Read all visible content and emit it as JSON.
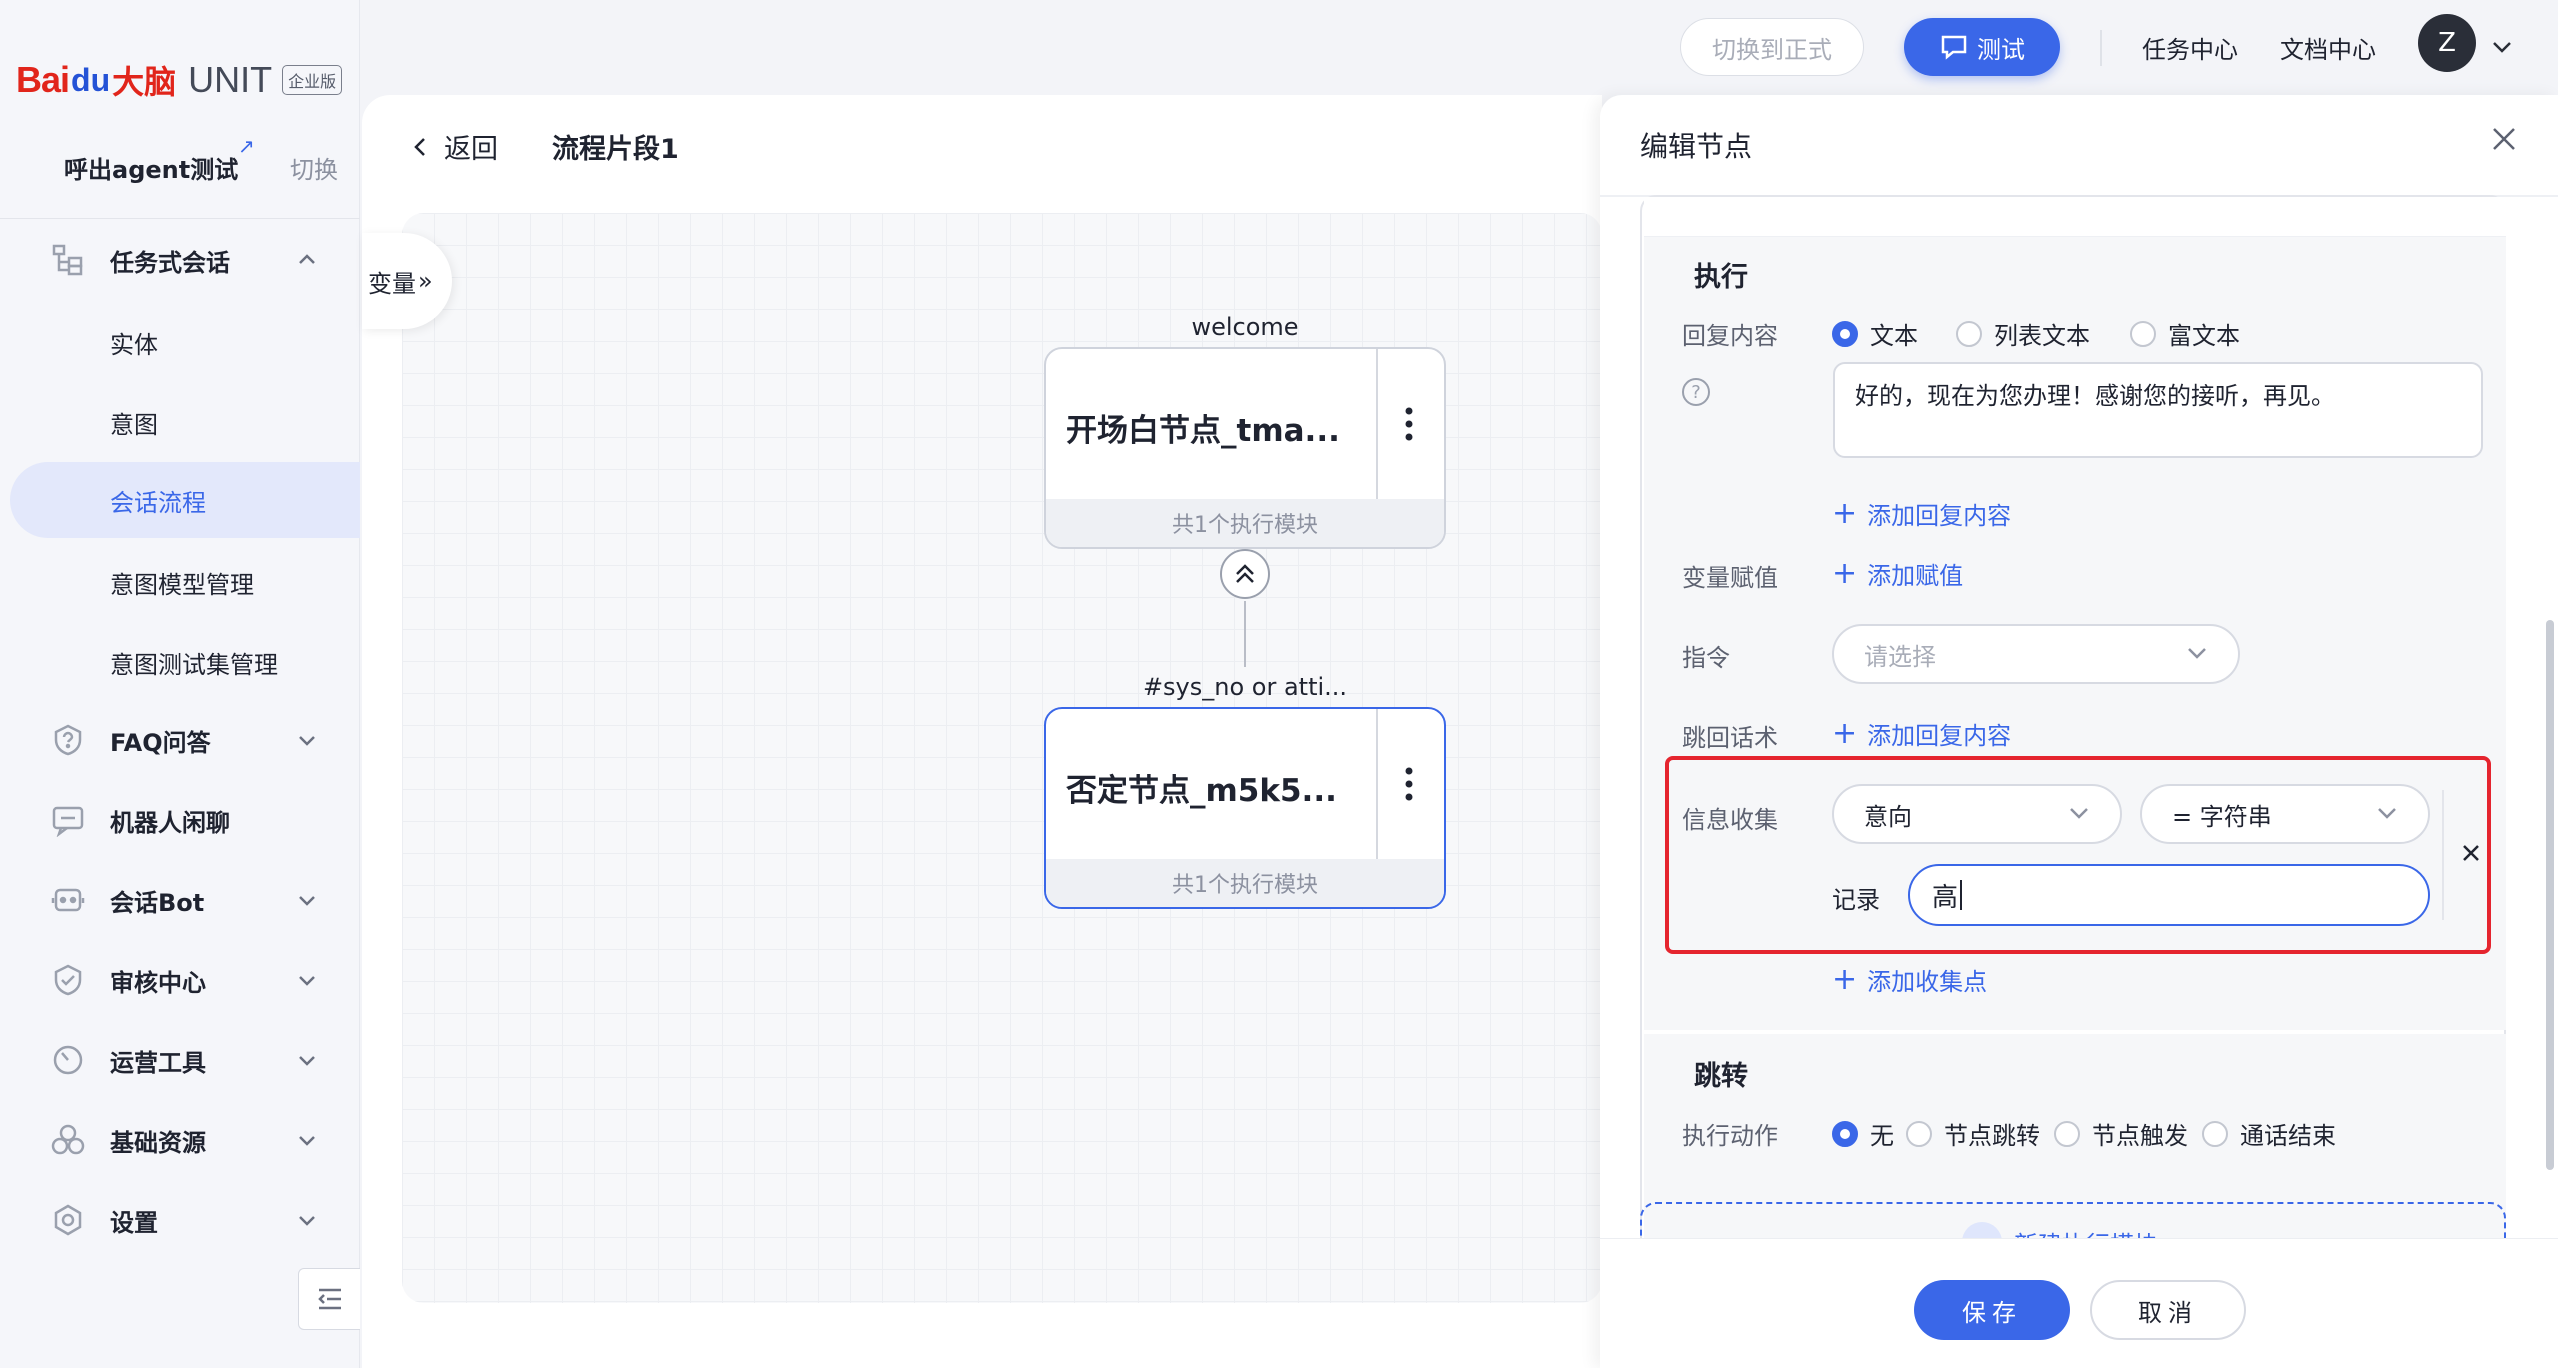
{
  "brand": {
    "bai": "Bai",
    "du": "du",
    "danao": "大脑",
    "unit": "UNIT",
    "edition": "企业版"
  },
  "agent": {
    "name": "呼出agent测试",
    "switch_label": "切换"
  },
  "sidebar": {
    "items": [
      {
        "label": "任务式会话",
        "icon": "tree-icon"
      },
      {
        "label": "FAQ问答",
        "icon": "question-shield-icon"
      },
      {
        "label": "机器人闲聊",
        "icon": "chat-icon"
      },
      {
        "label": "会话Bot",
        "icon": "bot-icon"
      },
      {
        "label": "审核中心",
        "icon": "shield-check-icon"
      },
      {
        "label": "运营工具",
        "icon": "gauge-icon"
      },
      {
        "label": "基础资源",
        "icon": "cubes-icon"
      },
      {
        "label": "设置",
        "icon": "hexagon-gear-icon"
      }
    ],
    "subitems": [
      "实体",
      "意图",
      "会话流程",
      "意图模型管理",
      "意图测试集管理"
    ],
    "active_subitem": "会话流程"
  },
  "topbar": {
    "switch_formal": "切换到正式",
    "test": "测试",
    "task_center": "任务中心",
    "doc_center": "文档中心",
    "avatar": "Z"
  },
  "canvas": {
    "back": "返回",
    "title": "流程片段1",
    "variables_tab": "变量",
    "nodes": [
      {
        "label": "welcome",
        "title": "开场白节点_tma...",
        "footer": "共1个执行模块"
      },
      {
        "label": "#sys_no or atti...",
        "title": "否定节点_m5k5...",
        "footer": "共1个执行模块"
      }
    ]
  },
  "drawer": {
    "title": "编辑节点",
    "exec_section": "执行",
    "reply_label": "回复内容",
    "reply_types": [
      "文本",
      "列表文本",
      "富文本"
    ],
    "reply_text": "好的，现在为您办理！感谢您的接听，再见。",
    "add_reply": "添加回复内容",
    "var_assign_label": "变量赋值",
    "add_assign": "添加赋值",
    "command_label": "指令",
    "command_placeholder": "请选择",
    "jump_back_label": "跳回话术",
    "add_jump_back": "添加回复内容",
    "collect_label": "信息收集",
    "collect_field": "意向",
    "collect_op": "= 字符串",
    "record_label": "记录",
    "record_value": "高",
    "add_collect": "添加收集点",
    "jump_section": "跳转",
    "action_label": "执行动作",
    "actions": [
      "无",
      "节点跳转",
      "节点触发",
      "通话结束"
    ],
    "new_module": "新建执行模块",
    "save": "保存",
    "cancel": "取消"
  },
  "colors": {
    "accent": "#3a67e8",
    "highlight_box": "#e5252f",
    "brand_red": "#e1251b"
  }
}
